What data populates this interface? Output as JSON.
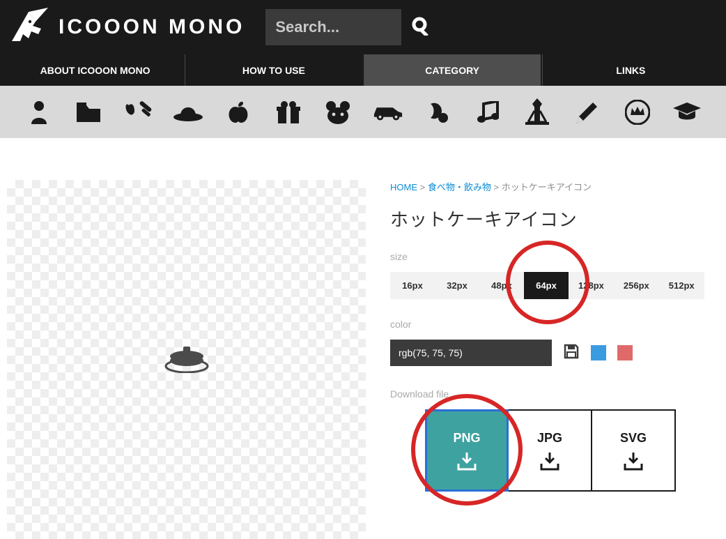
{
  "header": {
    "site_name": "ICOOON MONO",
    "search_placeholder": "Search..."
  },
  "nav": {
    "items": [
      {
        "label": "ABOUT ICOOON MONO",
        "active": false
      },
      {
        "label": "HOW TO USE",
        "active": false
      },
      {
        "label": "CATEGORY",
        "active": true
      },
      {
        "label": "LINKS",
        "active": false
      }
    ]
  },
  "categories": [
    "person",
    "folder",
    "health",
    "hat",
    "apple",
    "gift",
    "animal",
    "vehicle",
    "sports",
    "music",
    "building",
    "pencil",
    "crown",
    "graduation"
  ],
  "breadcrumb": {
    "home_label": "HOME",
    "sep": ">",
    "category_label": "食べ物・飲み物",
    "current": "ホットケーキアイコン"
  },
  "page_title": "ホットケーキアイコン",
  "size": {
    "label": "size",
    "options": [
      "16px",
      "32px",
      "48px",
      "64px",
      "128px",
      "256px",
      "512px"
    ],
    "selected": "64px"
  },
  "color": {
    "label": "color",
    "value": "rgb(75, 75, 75)"
  },
  "download": {
    "label": "Download file",
    "options": [
      "PNG",
      "JPG",
      "SVG"
    ],
    "selected": "PNG"
  }
}
